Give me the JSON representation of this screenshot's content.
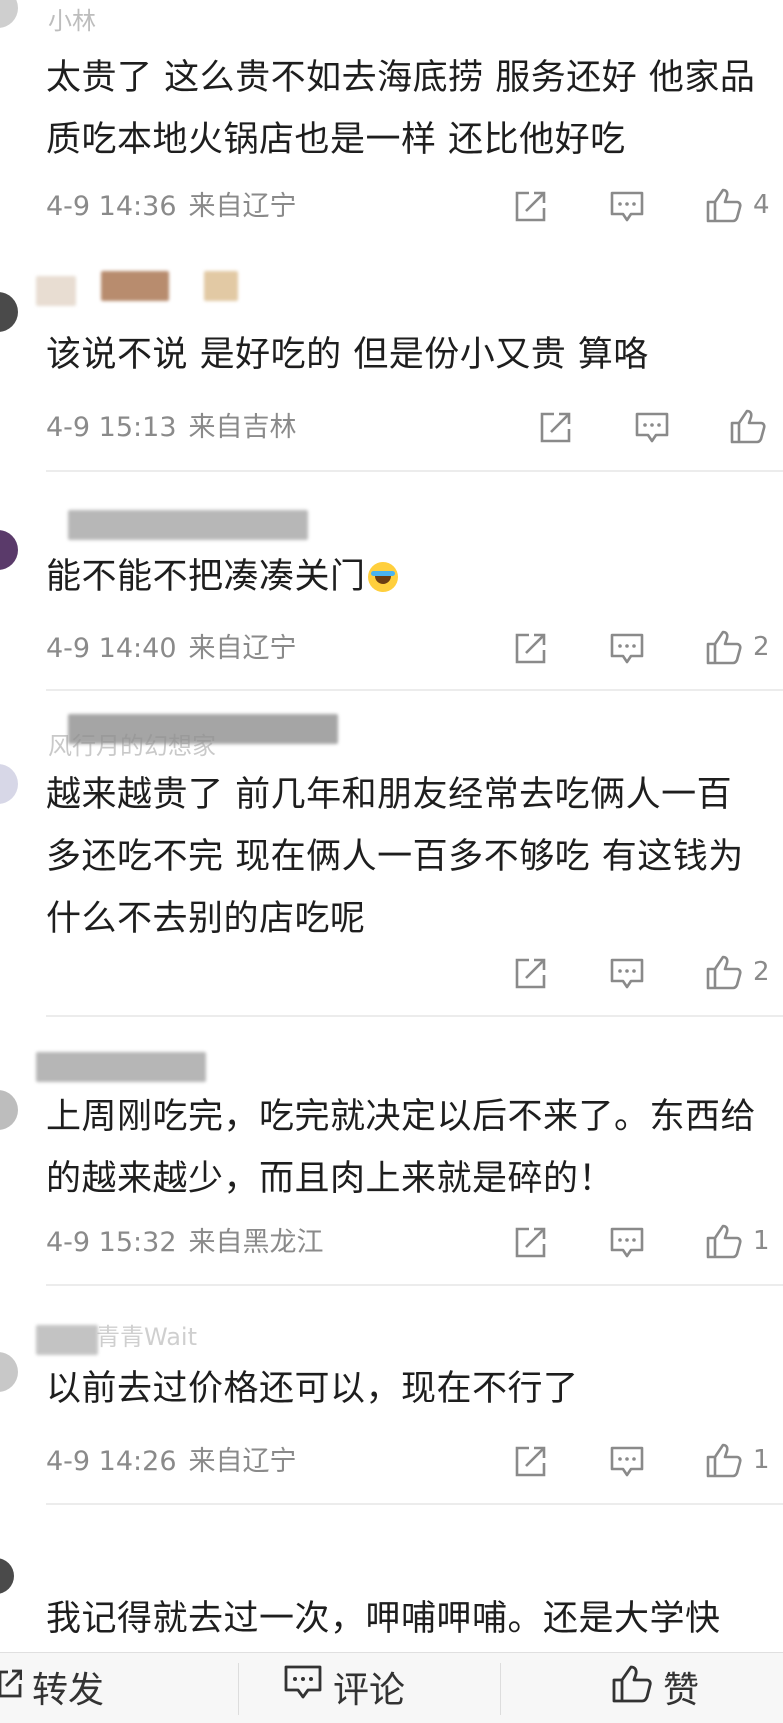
{
  "comments": [
    {
      "username": "小林",
      "text": "太贵了 这么贵不如去海底捞 服务还好 他家品质吃本地火锅店也是一样 还比他好吃",
      "time": "4-9 14:36",
      "location": "来自辽宁",
      "likes": "4"
    },
    {
      "username": "",
      "text": "该说不说 是好吃的 但是份小又贵 算咯",
      "time": "4-9 15:13",
      "location": "来自吉林",
      "likes": ""
    },
    {
      "username": "",
      "text": "能不能不把凑凑关门",
      "time": "4-9 14:40",
      "location": "来自辽宁",
      "likes": "2"
    },
    {
      "username": "风行月的幻想家",
      "text": "越来越贵了 前几年和朋友经常去吃俩人一百多还吃不完 现在俩人一百多不够吃 有这钱为什么不去别的店吃呢",
      "time": "",
      "location": "",
      "likes": "2"
    },
    {
      "username": "",
      "text": "上周刚吃完，吃完就决定以后不来了。东西给的越来越少，而且肉上来就是碎的！",
      "time": "4-9 15:32",
      "location": "来自黑龙江",
      "likes": "1"
    },
    {
      "username": "青青Wait",
      "text": "以前去过价格还可以，现在不行了",
      "time": "4-9 14:26",
      "location": "来自辽宁",
      "likes": "1"
    },
    {
      "username": "",
      "text": "我记得就去过一次，呷哺呷哺。还是大学快",
      "time": "",
      "location": "",
      "likes": ""
    }
  ],
  "icons": {
    "share": "share-icon",
    "comment": "comment-icon",
    "like": "thumbs-up-icon"
  },
  "bottom_bar": {
    "repost_label": "转发",
    "comment_label": "评论",
    "like_label": "赞"
  }
}
